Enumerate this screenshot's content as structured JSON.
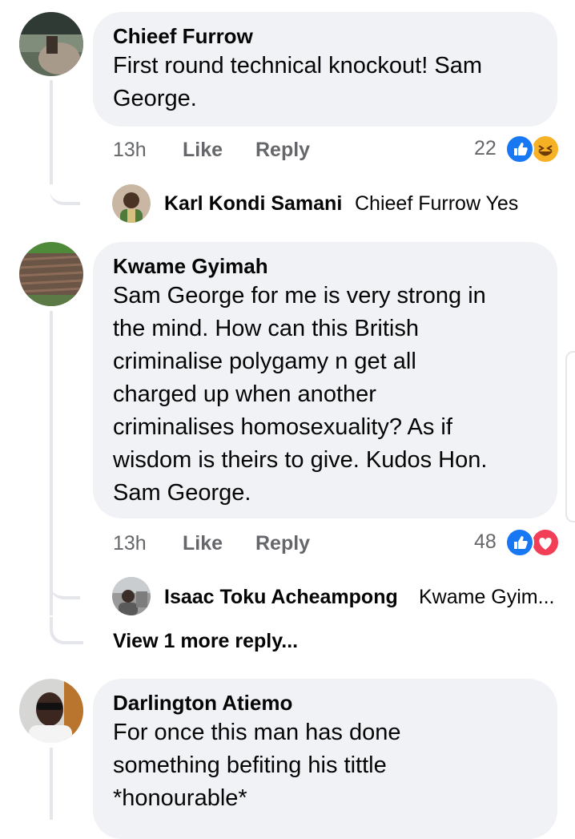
{
  "comments": [
    {
      "author": "Chieef Furrow",
      "text_lines": [
        "First round technical knockout! Sam",
        "George."
      ],
      "time": "13h",
      "like_label": "Like",
      "reply_label": "Reply",
      "reaction_count": "22",
      "reactions": [
        "like-icon",
        "haha-icon"
      ],
      "replies": [
        {
          "author": "Karl Kondi Samani",
          "text": "Chieef Furrow Yes"
        }
      ]
    },
    {
      "author": "Kwame Gyimah",
      "text_lines": [
        "Sam George for me is very strong in",
        "the mind. How can this British",
        "criminalise polygamy n get all",
        "charged up when another",
        "criminalises homosexuality? As if",
        "wisdom is theirs to give. Kudos Hon.",
        "Sam George."
      ],
      "time": "13h",
      "like_label": "Like",
      "reply_label": "Reply",
      "reaction_count": "48",
      "reactions": [
        "like-icon",
        "love-icon"
      ],
      "replies": [
        {
          "author": "Isaac Toku Acheampong",
          "text": "Kwame Gyim..."
        }
      ],
      "view_more": "View 1 more reply..."
    },
    {
      "author": "Darlington Atiemo",
      "text_lines": [
        "For once this man has done",
        "something befiting his tittle",
        "*honourable*"
      ]
    }
  ],
  "colors": {
    "bubble": "#f0f2f5",
    "muted": "#65676b",
    "like_blue": "#1877f2",
    "love_red": "#f33e58",
    "haha_yellow": "#f7b125"
  }
}
